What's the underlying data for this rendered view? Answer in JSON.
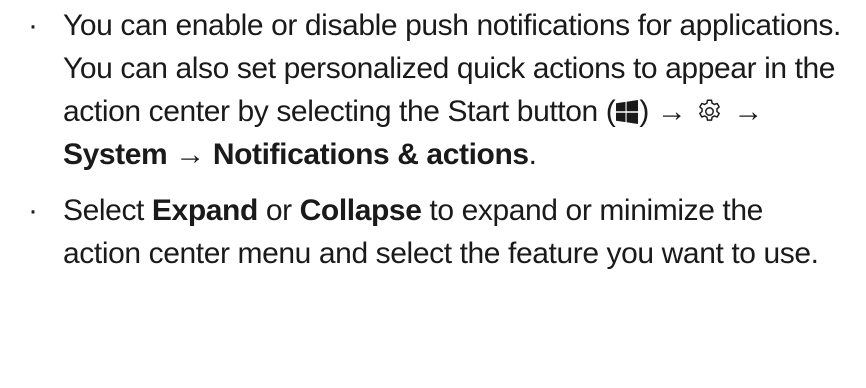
{
  "bullet_symbol": "·",
  "items": [
    {
      "part1": "You can enable or disable push notifications for applications. You can also set personalized quick actions to appear in the action center by selecting the Start button (",
      "part2": ") → ",
      "part3": " → ",
      "bold1": "System",
      "part4": " → ",
      "bold2": "Notifications & actions",
      "part5": "."
    },
    {
      "part1": "Select ",
      "bold1": "Expand",
      "part2": " or ",
      "bold2": "Collapse",
      "part3": " to expand or minimize the action center menu and select the feature you want to use."
    }
  ],
  "icons": {
    "start": "windows-start-icon",
    "settings": "gear-icon"
  }
}
